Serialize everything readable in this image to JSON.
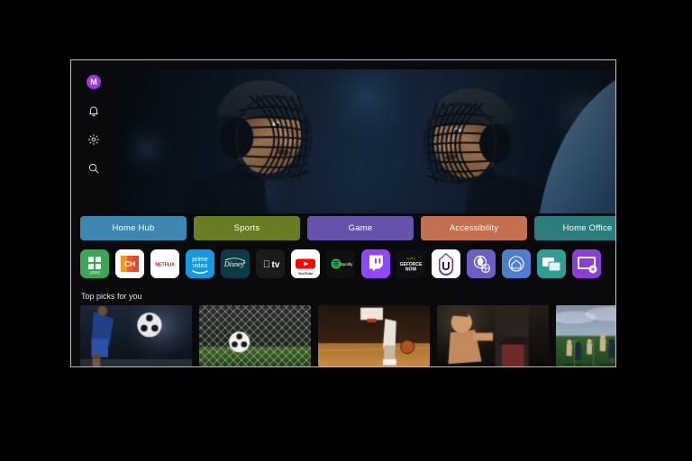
{
  "device": {
    "type": "tv-screen",
    "os_home": "webOS Home"
  },
  "side_rail": {
    "items": [
      {
        "name": "profile-avatar",
        "label": "M",
        "icon": "profile-avatar",
        "color": "#a234e0"
      },
      {
        "name": "notifications",
        "label": "",
        "icon": "bell-icon"
      },
      {
        "name": "settings",
        "label": "",
        "icon": "gear-icon"
      },
      {
        "name": "search",
        "label": "",
        "icon": "search-icon"
      }
    ]
  },
  "hero": {
    "name": "hero-banner",
    "description": "Two ice hockey players face to face in cage helmets",
    "alt": "Hockey face-off"
  },
  "categories": [
    {
      "label": "Home Hub",
      "color": "#3c87b0"
    },
    {
      "label": "Sports",
      "color": "#6b7d22"
    },
    {
      "label": "Game",
      "color": "#6552aa"
    },
    {
      "label": "Accessibility",
      "color": "#c2704f"
    },
    {
      "label": "Home Office",
      "color": "#2e7d7d"
    }
  ],
  "apps": [
    {
      "name": "apps",
      "label": "APPS",
      "bg": "#3aa757",
      "kind": "apps"
    },
    {
      "name": "lg-channels",
      "label": "CH",
      "bg": "#ffffff",
      "kind": "lgchannels"
    },
    {
      "name": "netflix",
      "label": "NETFLIX",
      "bg": "#ffffff",
      "kind": "netflix"
    },
    {
      "name": "prime-video",
      "label": "prime video",
      "bg": "#1399e0",
      "kind": "prime"
    },
    {
      "name": "disney-plus",
      "label": "Disney+",
      "bg": "#0b3c44",
      "kind": "disney"
    },
    {
      "name": "apple-tv",
      "label": "tv",
      "bg": "#1b1b1b",
      "kind": "appletv"
    },
    {
      "name": "youtube",
      "label": "YouTube",
      "bg": "#ffffff",
      "kind": "youtube"
    },
    {
      "name": "spotify",
      "label": "Spotify",
      "bg": "#101010",
      "kind": "spotify"
    },
    {
      "name": "twitch",
      "label": "Twitch",
      "bg": "#9146ff",
      "kind": "twitch"
    },
    {
      "name": "geforce-now",
      "label": "GEFORCE NOW",
      "bg": "#101010",
      "kind": "geforce"
    },
    {
      "name": "u-app",
      "label": "U",
      "bg": "#ffffff",
      "kind": "uapp"
    },
    {
      "name": "sports-hub",
      "label": "",
      "bg": "#6a5fc4",
      "kind": "sportsball"
    },
    {
      "name": "home-dashboard",
      "label": "",
      "bg": "#4f7ed1",
      "kind": "homedash"
    },
    {
      "name": "multi-view",
      "label": "",
      "bg": "#2f9e94",
      "kind": "multiview"
    },
    {
      "name": "screen-share",
      "label": "",
      "bg": "#8b3fd4",
      "kind": "screenshare"
    }
  ],
  "top_picks": {
    "title": "Top picks for you",
    "cards": [
      {
        "name": "soccer-kick",
        "alt": "Soccer player kicking ball"
      },
      {
        "name": "goal-net",
        "alt": "Ball hitting the goal net"
      },
      {
        "name": "basketball-court",
        "alt": "Basketball player dribbling on court"
      },
      {
        "name": "boxing-bag",
        "alt": "Boxer hitting a heavy bag"
      },
      {
        "name": "american-football",
        "alt": "American football players on field"
      }
    ]
  },
  "colors": {
    "background": "#000000",
    "bezel": "#b9bcc0",
    "screen": "#0a0a0c",
    "text": "#e3e3e6"
  }
}
